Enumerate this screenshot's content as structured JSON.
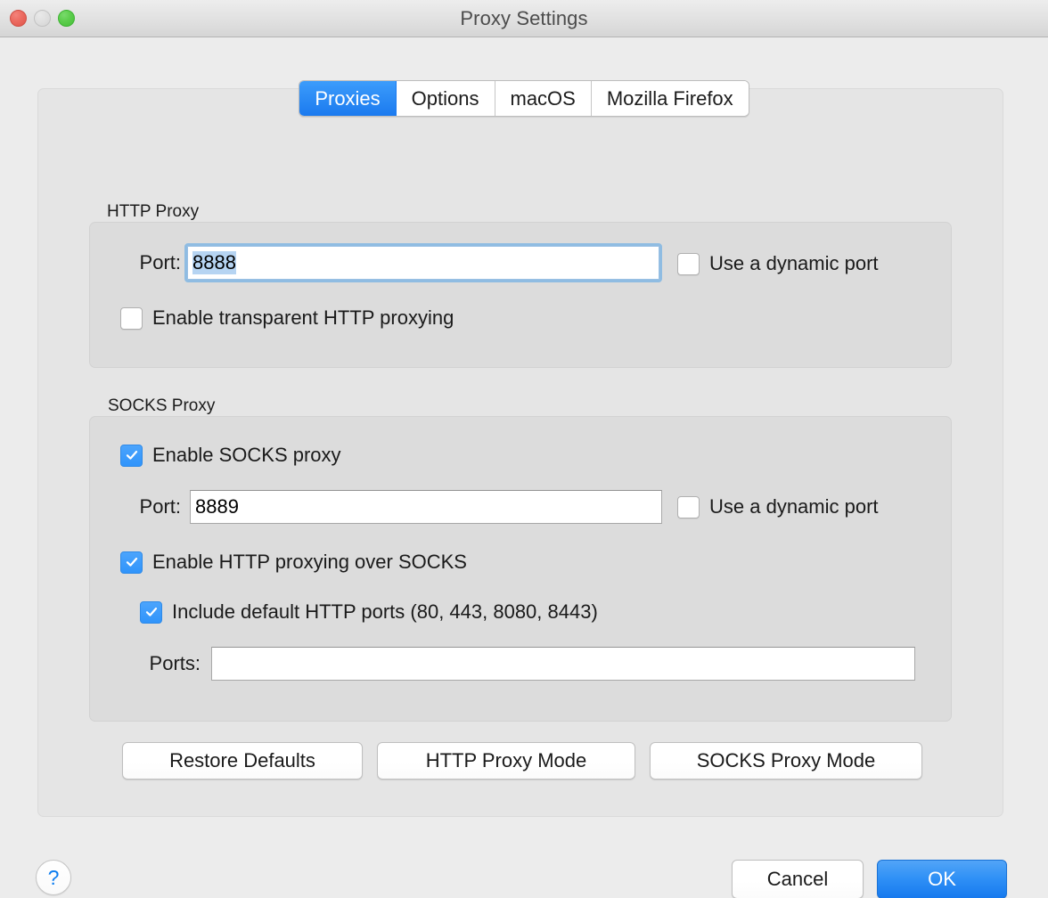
{
  "window": {
    "title": "Proxy Settings",
    "traffic_lights": [
      {
        "name": "close",
        "color": "#ec6a60"
      },
      {
        "name": "minimize",
        "color": "#dedede"
      },
      {
        "name": "maximize",
        "color": "#5ccd4c"
      }
    ]
  },
  "tabs": [
    {
      "label": "Proxies",
      "selected": true
    },
    {
      "label": "Options",
      "selected": false
    },
    {
      "label": "macOS",
      "selected": false
    },
    {
      "label": "Mozilla Firefox",
      "selected": false
    }
  ],
  "http_proxy": {
    "group_label": "HTTP Proxy",
    "port_label": "Port:",
    "port_value": "8888",
    "port_focused": true,
    "port_selected": true,
    "dynamic_port": {
      "label": "Use a dynamic port",
      "checked": false
    },
    "transparent": {
      "label": "Enable transparent HTTP proxying",
      "checked": false
    }
  },
  "socks_proxy": {
    "group_label": "SOCKS Proxy",
    "enable": {
      "label": "Enable SOCKS proxy",
      "checked": true
    },
    "port_label": "Port:",
    "port_value": "8889",
    "dynamic_port": {
      "label": "Use a dynamic port",
      "checked": false
    },
    "http_over_socks": {
      "label": "Enable HTTP proxying over SOCKS",
      "checked": true
    },
    "include_defaults": {
      "label": "Include default HTTP ports (80, 443, 8080, 8443)",
      "checked": true
    },
    "ports_label": "Ports:",
    "ports_value": "",
    "ports_placeholder": ""
  },
  "mode_buttons": {
    "restore_defaults": "Restore Defaults",
    "http_proxy_mode": "HTTP Proxy Mode",
    "socks_proxy_mode": "SOCKS Proxy Mode"
  },
  "footer": {
    "help": "?",
    "cancel": "Cancel",
    "ok": "OK"
  },
  "colors": {
    "accent_blue": "#1b7aef",
    "checkbox_blue": "#3094fb",
    "window_bg": "#ececec",
    "panel_bg": "#e5e5e5",
    "group_bg": "#dcdcdc",
    "focus_ring": "#8fbce2",
    "selection": "#b6d4f2"
  }
}
